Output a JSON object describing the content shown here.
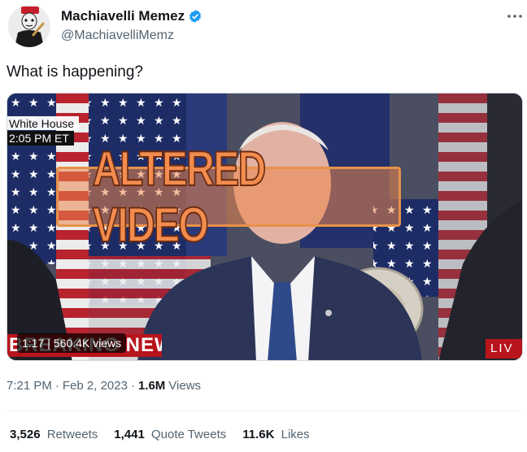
{
  "author": {
    "display_name": "Machiavelli Memez",
    "handle": "@MachiavelliMemz"
  },
  "tweet": {
    "text": "What is happening?"
  },
  "media": {
    "location_label": "White House",
    "time_label": "2:05 PM ET",
    "overlay_text": "ALTERED VIDEO",
    "breaking_label": "BREAKING NEWS",
    "live_label": "LIV",
    "duration": "1:17",
    "stats_separator": "|",
    "views": "560.4K views"
  },
  "meta": {
    "time": "7:21 PM",
    "dot": "·",
    "date": "Feb 2, 2023",
    "views_count": "1.6M",
    "views_label": "Views"
  },
  "stats": {
    "retweets_count": "3,526",
    "retweets_label": "Retweets",
    "quotes_count": "1,441",
    "quotes_label": "Quote Tweets",
    "likes_count": "11.6K",
    "likes_label": "Likes"
  },
  "icons": {
    "verified": "verified-badge-icon",
    "more": "more-options-icon"
  },
  "colors": {
    "verified_blue": "#1d9bf0",
    "secondary_text": "#536471",
    "overlay_orange": "#f28c4f",
    "breaking_red": "#b8141c"
  }
}
